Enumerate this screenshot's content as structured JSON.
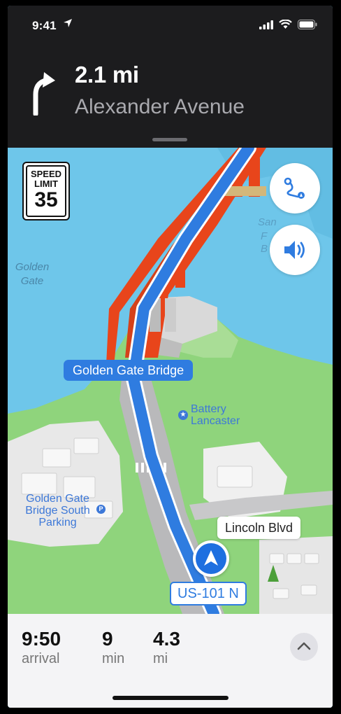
{
  "status": {
    "time": "9:41"
  },
  "guidance": {
    "distance": "2.1 mi",
    "street": "Alexander Avenue"
  },
  "speed_limit": {
    "line1": "SPEED",
    "line2": "LIMIT",
    "value": "35"
  },
  "map": {
    "water_label_golden": "Golden",
    "water_label_gate": "Gate",
    "area_label_san": "San",
    "area_label_f": "F",
    "area_label_b": "B",
    "bridge_callout": "Golden Gate Bridge",
    "poi_battery_1": "Battery",
    "poi_battery_2": "Lancaster",
    "poi_parking_1": "Golden Gate",
    "poi_parking_2": "Bridge South",
    "poi_parking_3": "Parking",
    "road_callout": "Lincoln Blvd",
    "route_shield": "US-101 N"
  },
  "trip": {
    "arrival_value": "9:50",
    "arrival_label": "arrival",
    "min_value": "9",
    "min_label": "min",
    "mi_value": "4.3",
    "mi_label": "mi"
  },
  "icons": {
    "route_overview": "route-overview-icon",
    "audio": "speaker-icon",
    "expand": "chevron-up-icon",
    "turn": "turn-left-arrow-icon"
  },
  "colors": {
    "route": "#2f7ce0",
    "bridge": "#e8451b",
    "water": "#6ec6ea",
    "land": "#8fd47c"
  }
}
